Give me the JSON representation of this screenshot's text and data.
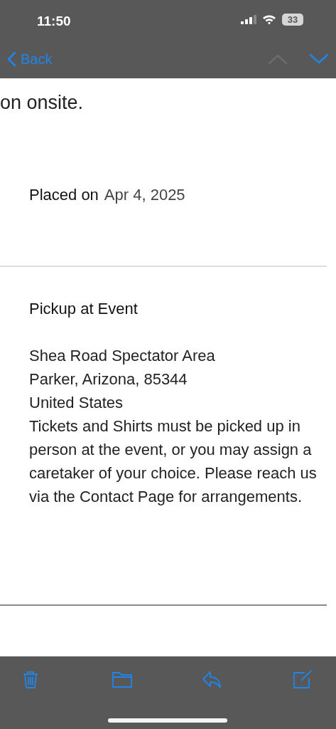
{
  "status_bar": {
    "time": "11:50",
    "battery": "33"
  },
  "nav": {
    "back": "Back",
    "previous": {
      "disabled": true
    },
    "next": {
      "disabled": false
    }
  },
  "message": {
    "cut_line": "on onsite.",
    "placed": {
      "label": "Placed on",
      "date": "Apr 4, 2025"
    },
    "pickup": {
      "title": "Pickup at Event",
      "lines": [
        "Shea Road Spectator Area",
        "Parker, Arizona, 85344",
        "United States"
      ],
      "note": "Tickets and Shirts must be picked up in person at the event, or you may assign a caretaker of your choice. Please reach us via the Contact Page for arrangements."
    }
  },
  "toolbar": [
    {
      "kind": "trash"
    },
    {
      "kind": "folder"
    },
    {
      "kind": "reply"
    },
    {
      "kind": "compose"
    }
  ]
}
